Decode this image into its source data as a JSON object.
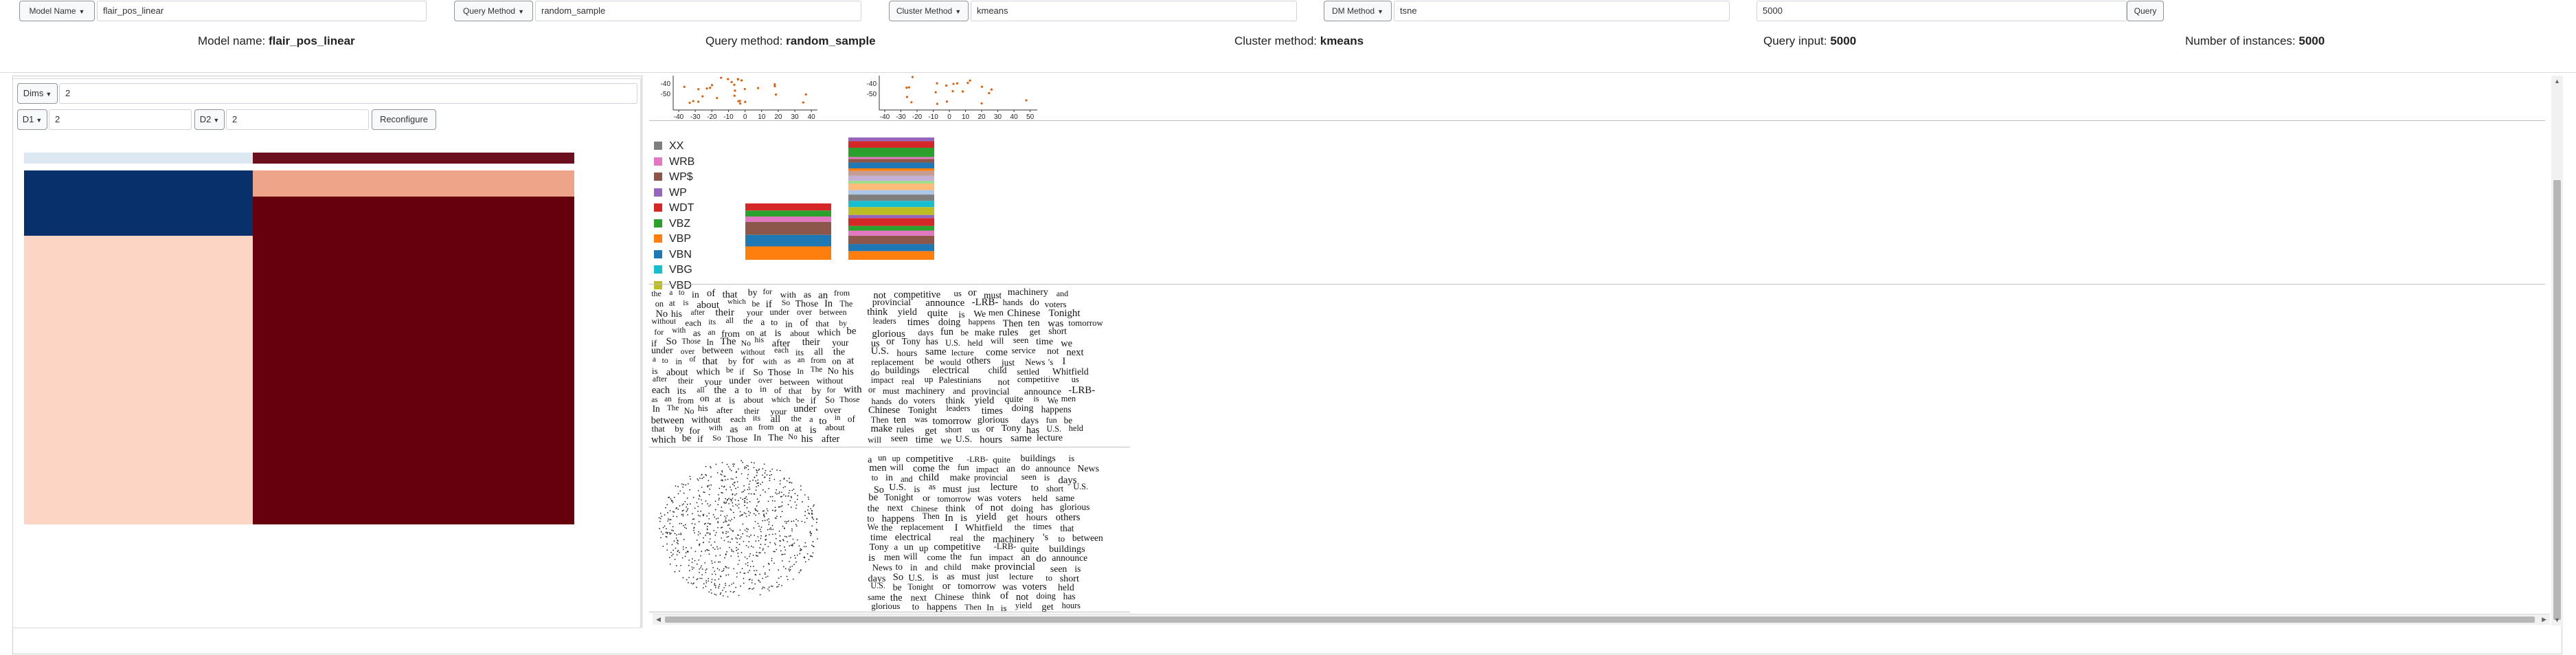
{
  "query_bar": {
    "model_name_btn": "Model Name",
    "model_name_value": "flair_pos_linear",
    "query_method_btn": "Query Method",
    "query_method_value": "random_sample",
    "cluster_method_btn": "Cluster Method",
    "cluster_method_value": "kmeans",
    "dm_method_btn": "DM Method",
    "dm_method_value": "tsne",
    "query_input_value": "5000",
    "query_btn": "Query"
  },
  "summary": {
    "model_label": "Model name: ",
    "model_value": "flair_pos_linear",
    "query_label": "Query method: ",
    "query_value": "random_sample",
    "cluster_label": "Cluster method: ",
    "cluster_value": "kmeans",
    "input_label": "Query input: ",
    "input_value": "5000",
    "instances_label": "Number of instances: ",
    "instances_value": "5000"
  },
  "controls": {
    "dims_btn": "Dims",
    "dims_value": "2",
    "d1_btn": "D1",
    "d1_value": "2",
    "d2_btn": "D2",
    "d2_value": "2",
    "reconfigure_btn": "Reconfigure"
  },
  "heatmap": {
    "colors": {
      "top_left": "#dce9f3",
      "top_right": "#6b0e1e",
      "mid_left": "#08306b",
      "mid_right": "#eea489",
      "bot_left": "#fcd5c5",
      "bot_right": "#67000d"
    }
  },
  "scatter_axes": {
    "plot1_yticks": [
      "-40",
      "-50"
    ],
    "plot1_xticks": [
      "-40",
      "-30",
      "-20",
      "-10",
      "0",
      "10",
      "20",
      "30",
      "40"
    ],
    "plot2_yticks": [
      "-40",
      "-50"
    ],
    "plot2_xticks": [
      "-40",
      "-30",
      "-20",
      "-10",
      "0",
      "10",
      "20",
      "30",
      "40",
      "50"
    ],
    "point_color": "#d95f0e"
  },
  "legend": [
    {
      "label": "XX",
      "color": "#7f7f7f"
    },
    {
      "label": "WRB",
      "color": "#e377c2"
    },
    {
      "label": "WP$",
      "color": "#8c564b"
    },
    {
      "label": "WP",
      "color": "#9467bd"
    },
    {
      "label": "WDT",
      "color": "#d62728"
    },
    {
      "label": "VBZ",
      "color": "#2ca02c"
    },
    {
      "label": "VBP",
      "color": "#ff7f0e"
    },
    {
      "label": "VBN",
      "color": "#1f77b4"
    },
    {
      "label": "VBG",
      "color": "#17becf"
    },
    {
      "label": "VBD",
      "color": "#bcbd22"
    }
  ],
  "wordcloud_function_words": [
    "the",
    "a",
    "to",
    "in",
    "of",
    "that",
    "by",
    "for",
    "with",
    "as",
    "an",
    "from",
    "on",
    "at",
    "is",
    "about",
    "which",
    "be",
    "if",
    "So",
    "Those",
    "In",
    "The",
    "No",
    "his",
    "after",
    "their",
    "your",
    "under",
    "over",
    "between",
    "without",
    "each",
    "its",
    "all"
  ],
  "wordcloud_content_words": [
    "not",
    "competitive",
    "us",
    "or",
    "must",
    "machinery",
    "and",
    "provincial",
    "announce",
    "-LRB-",
    "hands",
    "do",
    "voters",
    "think",
    "yield",
    "quite",
    "is",
    "We",
    "men",
    "Chinese",
    "Tonight",
    "leaders",
    "times",
    "doing",
    "happens",
    "Then",
    "ten",
    "was",
    "tomorrow",
    "glorious",
    "days",
    "fun",
    "be",
    "make",
    "rules",
    "get",
    "short",
    "us",
    "or",
    "Tony",
    "has",
    "U.S.",
    "held",
    "will",
    "seen",
    "time",
    "we",
    "U.S.",
    "hours",
    "same",
    "lecture",
    "come",
    "service",
    "not",
    "next",
    "replacement",
    "be",
    "would",
    "others",
    "just",
    "News",
    "'s",
    "I",
    "do",
    "buildings",
    "electrical",
    "child",
    "settled",
    "Whitfield",
    "impact",
    "real",
    "up",
    "Palestinians"
  ],
  "wordcloud_content_words_2": [
    "a",
    "un",
    "up",
    "competitive",
    "-LRB-",
    "quite",
    "buildings",
    "is",
    "men",
    "will",
    "come",
    "the",
    "fun",
    "impact",
    "an",
    "do",
    "announce",
    "News",
    "to",
    "in",
    "and",
    "child",
    "make",
    "provincial",
    "seen",
    "is",
    "days",
    "So",
    "U.S.",
    "is",
    "as",
    "must",
    "just",
    "lecture",
    "to",
    "short",
    "U.S.",
    "be",
    "Tonight",
    "or",
    "tomorrow",
    "was",
    "voters",
    "held",
    "same",
    "the",
    "next",
    "Chinese",
    "think",
    "of",
    "not",
    "doing",
    "has",
    "glorious",
    "to",
    "happens",
    "Then",
    "In",
    "is",
    "yield",
    "get",
    "hours",
    "others",
    "We",
    "the",
    "replacement",
    "I",
    "Whitfield",
    "the",
    "times",
    "that",
    "time",
    "electrical",
    "real",
    "the",
    "machinery",
    "'s",
    "to",
    "between",
    "Tony"
  ]
}
